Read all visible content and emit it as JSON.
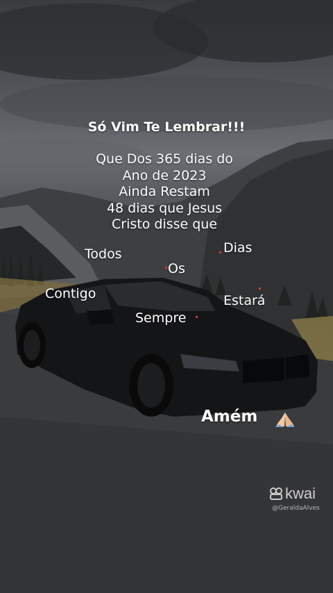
{
  "post": {
    "title": "Só Vim Te Lembrar!!!",
    "lines": [
      "Que Dos 365 dias do",
      "Ano de 2023",
      "Ainda Restam",
      "48 dias que Jesus",
      "Cristo disse que"
    ],
    "scattered_words": {
      "todos": "Todos",
      "dias": "Dias",
      "os": "Os",
      "contigo": "Contigo",
      "estara": "Estará",
      "sempre": "Sempre"
    },
    "closing": "Amém",
    "closing_emoji": "praying-hands-icon"
  },
  "watermark": {
    "brand": "kwai",
    "handle": "@GeraldaAlves"
  },
  "colors": {
    "text": "#ffffff",
    "accent_dot": "#ff3b3b",
    "car": "#141517"
  }
}
